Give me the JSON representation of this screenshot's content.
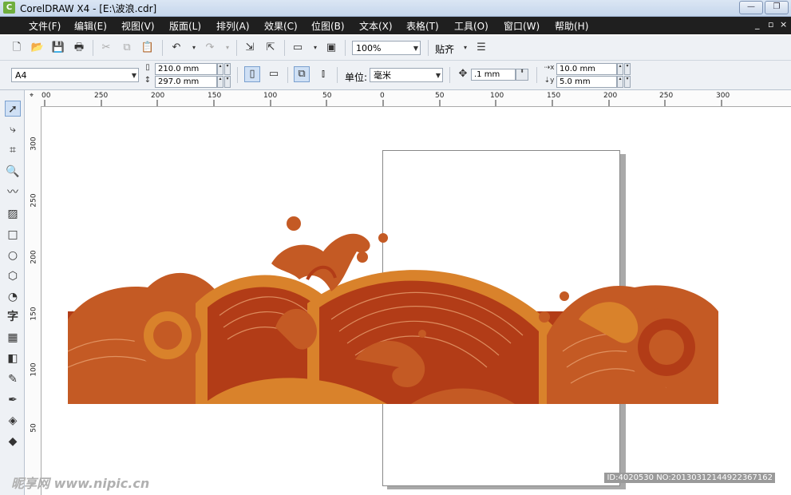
{
  "app": {
    "title": "CorelDRAW X4 - [E:\\波浪.cdr]",
    "icon_name": "coreldraw-logo-icon"
  },
  "menu": [
    "文件(F)",
    "编辑(E)",
    "视图(V)",
    "版面(L)",
    "排列(A)",
    "效果(C)",
    "位图(B)",
    "文本(X)",
    "表格(T)",
    "工具(O)",
    "窗口(W)",
    "帮助(H)"
  ],
  "toolbar": {
    "zoom": "100%",
    "snap_label": "贴齐"
  },
  "propertybar": {
    "page_size": "A4",
    "width": "210.0 mm",
    "height": "297.0 mm",
    "units_label": "单位:",
    "units_value": "毫米",
    "nudge": ".1 mm",
    "dup_x": "10.0 mm",
    "dup_y": "5.0 mm"
  },
  "hruler_ticks": [
    "00",
    "250",
    "200",
    "150",
    "100",
    "50",
    "0",
    "50",
    "100",
    "150",
    "200",
    "250",
    "300"
  ],
  "vruler_ticks": [
    "300",
    "250",
    "200",
    "150",
    "100",
    "50"
  ],
  "watermark": {
    "left": "昵享网 www.nipic.cn",
    "right": "ID:4020530 NO:20130312144922367162"
  },
  "colors": {
    "wave_dark": "#b23c17",
    "wave_orange": "#d9822b",
    "wave_mid": "#c45a24",
    "line": "#e8a070"
  }
}
